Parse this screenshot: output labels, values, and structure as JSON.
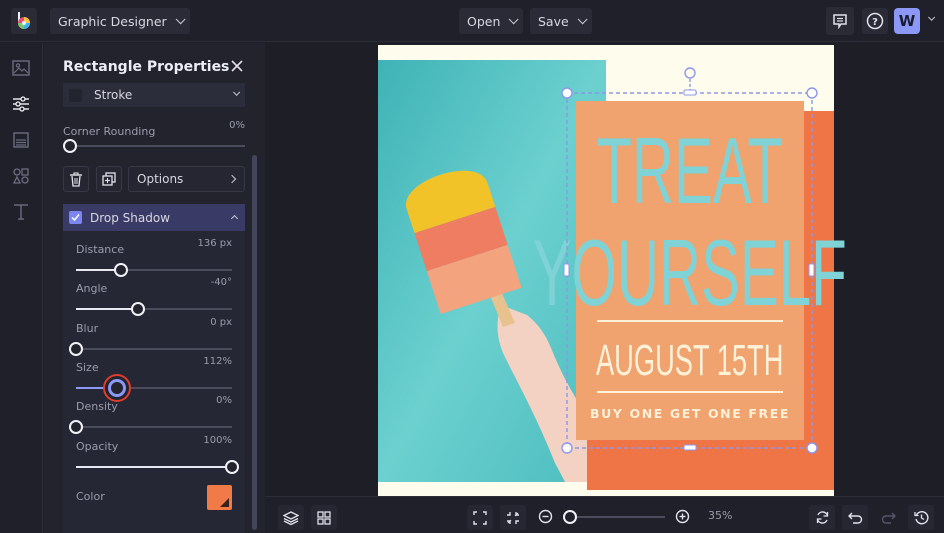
{
  "app": {
    "project_name": "Graphic Designer",
    "menu": {
      "open_label": "Open",
      "save_label": "Save"
    },
    "avatar_initial": "W",
    "accent": "#8b98f5"
  },
  "rail": {
    "items": [
      {
        "name": "images",
        "icon": "image-icon",
        "active": false
      },
      {
        "name": "adjustments",
        "icon": "sliders-icon",
        "active": true
      },
      {
        "name": "backgrounds",
        "icon": "background-icon",
        "active": false
      },
      {
        "name": "graphics",
        "icon": "shapes-icon",
        "active": false
      },
      {
        "name": "text",
        "icon": "text-icon",
        "active": false
      }
    ]
  },
  "panel": {
    "title": "Rectangle Properties",
    "stroke_label": "Stroke",
    "corner_rounding": {
      "label": "Corner Rounding",
      "value": "0%",
      "fraction": 0.0
    },
    "options_label": "Options",
    "drop_shadow": {
      "label": "Drop Shadow",
      "enabled": true,
      "fields": [
        {
          "label": "Distance",
          "value": "136 px",
          "fraction": 0.29
        },
        {
          "label": "Angle",
          "value": "-40°",
          "fraction": 0.4
        },
        {
          "label": "Blur",
          "value": "0 px",
          "fraction": 0.0
        },
        {
          "label": "Size",
          "value": "112%",
          "fraction": 0.26,
          "highlighted": true
        },
        {
          "label": "Density",
          "value": "0%",
          "fraction": 0.0
        },
        {
          "label": "Opacity",
          "value": "100%",
          "fraction": 1.0
        }
      ],
      "color_label": "Color",
      "color": "#f07b48"
    }
  },
  "canvas": {
    "headline_1": "TREAT",
    "headline_2": "YOURSELF",
    "date": "AUGUST 15TH",
    "tagline": "BUY ONE GET ONE FREE",
    "colors": {
      "background": "#fefcec",
      "teal": "#5cc6c8",
      "card": "#f0a26f",
      "shadow": "#ef7446",
      "text_teal": "#7fd3d6",
      "text_cream": "#fdf1d8"
    }
  },
  "bottom": {
    "zoom_label": "35%",
    "zoom_fraction": 0.05
  }
}
